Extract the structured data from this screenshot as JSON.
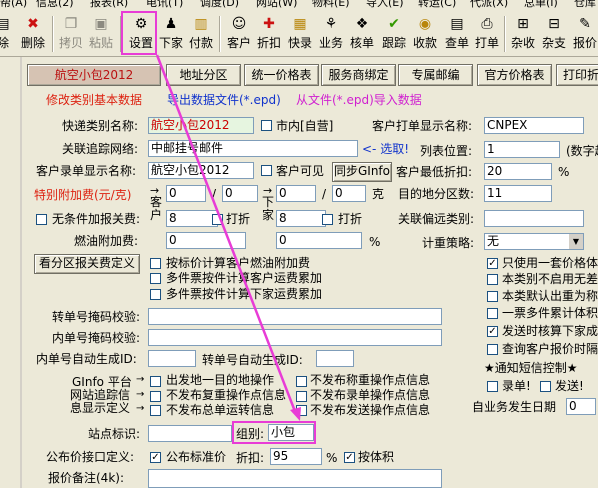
{
  "menubar": [
    "帮(A)",
    "信息(2)",
    "报表(R)",
    "电讯(T)",
    "调度(D)",
    "网站(W)",
    "物料(E)",
    "导入(E)",
    "转运(C)",
    "代派(X)",
    "总单(I)",
    "仓库"
  ],
  "toolbar": {
    "items": [
      {
        "label": "除",
        "icon": "delete-icon"
      },
      {
        "label": "删除",
        "icon": "x-icon"
      },
      {
        "label": "拷贝",
        "icon": "copy-icon"
      },
      {
        "label": "粘贴",
        "icon": "paste-icon"
      },
      {
        "label": "设置",
        "icon": "settings-icon"
      },
      {
        "label": "下家",
        "icon": "next-icon"
      },
      {
        "label": "付款",
        "icon": "payment-icon"
      },
      {
        "label": "客户",
        "icon": "customer-icon"
      },
      {
        "label": "折扣",
        "icon": "discount-icon"
      },
      {
        "label": "快录",
        "icon": "quick-entry-icon"
      },
      {
        "label": "业务",
        "icon": "business-icon"
      },
      {
        "label": "核单",
        "icon": "verify-icon"
      },
      {
        "label": "跟踪",
        "icon": "track-icon"
      },
      {
        "label": "收款",
        "icon": "receive-icon"
      },
      {
        "label": "查单",
        "icon": "query-icon"
      },
      {
        "label": "打单",
        "icon": "print-icon"
      },
      {
        "label": "杂收",
        "icon": "misc-in-icon"
      },
      {
        "label": "杂支",
        "icon": "misc-out-icon"
      },
      {
        "label": "报价",
        "icon": "quote-icon"
      }
    ]
  },
  "top_buttons": {
    "type_name": "航空小包2012",
    "area": "地址分区",
    "unified_price": "统一价格表",
    "service": "服务商绑定",
    "dedicated_mail": "专属邮编",
    "official_price": "官方价格表",
    "print": "打印折"
  },
  "links": {
    "edit_type": "修改类别基本数据",
    "export": "导出数据文件(*.epd)",
    "import": "从文件(*.epd)导入数据"
  },
  "form": {
    "express_type_label": "快递类别名称:",
    "express_type_value": "航空小包2012",
    "city_label": "市内[自营]",
    "customer_print_label": "客户打单显示名称:",
    "customer_print_value": "CNPEX",
    "tracking_label": "关联追踪网络:",
    "tracking_value": "中邮挂号邮件",
    "select_label": "<- 选取!",
    "list_pos_label": "列表位置:",
    "list_pos_value": "1",
    "list_pos_hint": "(数字越",
    "customer_entry_label": "客户录单显示名称:",
    "customer_entry_value": "航空小包2012",
    "customer_visible_label": "客户可见",
    "sync_button": "同步GInfo",
    "min_discount_label": "客户最低折扣:",
    "min_discount_value": "20",
    "percent": "%",
    "surcharge_label": "特别附加费(元/克)",
    "zero": "0",
    "slash": "/",
    "gram": "克",
    "dest_zones_label": "目的地分区数:",
    "dest_zones_value": "11",
    "no_cond_label": "无条件加报关费:",
    "eight": "8",
    "discount_label": "打折",
    "related_dev_label": "关联偏远类别:",
    "customer_vert": "客户",
    "downstream_vert": "下家",
    "fuel_label": "燃油附加费:",
    "billing_policy_label": "计重策略:",
    "billing_policy_value": "无",
    "zone_fee_button": "看分区报关费定义",
    "opt_tag_fuel": "按标价计算客户燃油附加费",
    "opt_multi_customer": "多件票按件计算客户运费累加",
    "opt_multi_downstream": "多件票按件计算下家运费累加",
    "right_opts": [
      {
        "label": "只使用一套价格体",
        "checked": true
      },
      {
        "label": "本类别不启用无差",
        "checked": false
      },
      {
        "label": "本类默认出重为称",
        "checked": false
      },
      {
        "label": "一票多件累计体积",
        "checked": false
      },
      {
        "label": "发送时核算下家成",
        "checked": true
      },
      {
        "label": "查询客户报价时隔",
        "checked": false
      }
    ],
    "sms_label": "★通知短信控制★",
    "record_label": "录单!",
    "send_label": "发送!",
    "auto_date_label": "自业务发生日期",
    "auto_date_value": "0",
    "transfer_mask_label": "转单号掩码校验:",
    "inner_mask_label": "内单号掩码校验:",
    "inner_auto_label": "内单号自动生成ID:",
    "transfer_auto_label": "转单号自动生成ID:",
    "ginfo_label": "GInfo 平台",
    "site_track_label": "网站追踪信",
    "info_def_label": "息显示定义",
    "opt_no_doc": "出发地一目的地操作",
    "opt_no_reweigh": "不发布复重操作点信息",
    "opt_no_mainline": "不发布总单运转信息",
    "opt_no_weigh": "不发布称重操作点信息",
    "opt_no_entry": "不发布录单操作点信息",
    "opt_no_send": "不发布发送操作点信息",
    "site_id_label": "站点标识:",
    "group_label": "组别:",
    "group_value": "小包",
    "public_price_label": "公布价接口定义:",
    "public_standard_label": "公布标准价",
    "discount2_label": "折扣:",
    "discount2_value": "95",
    "by_volume_label": "按体积",
    "quote_remark_label": "报价备注(4k):"
  },
  "accent": {
    "highlight": "#e83cd6",
    "link_red": "#d21",
    "link_blue": "#1133cc",
    "link_magenta": "#d020d0"
  }
}
